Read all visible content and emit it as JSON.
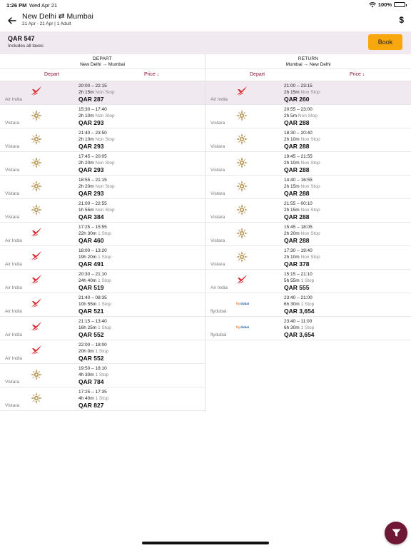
{
  "status_bar": {
    "time": "1:26 PM",
    "date": "Wed Apr 21",
    "battery": "100%"
  },
  "header": {
    "title": "New Delhi ⇄ Mumbai",
    "subtitle": "21 Apr - 21 Apr | 1 Adult",
    "back_icon": "arrow-left-icon",
    "currency_icon": "dollar-icon"
  },
  "summary": {
    "price": "QAR 547",
    "note": "Includes all taxes",
    "book_label": "Book"
  },
  "depart": {
    "heading": "DEPART",
    "route": "New Delhi → Mumbai",
    "sort_left": "Depart",
    "sort_right": "Price ↓",
    "flights": [
      {
        "airline": "Air India",
        "logo": "air-india",
        "times": "20:00  –  22:15",
        "duration": "2h 15m",
        "stops": "Non Stop",
        "price": "QAR 287",
        "selected": true
      },
      {
        "airline": "Vistara",
        "logo": "vistara",
        "times": "15:30  –  17:40",
        "duration": "2h 10m",
        "stops": "Non Stop",
        "price": "QAR 293"
      },
      {
        "airline": "Vistara",
        "logo": "vistara",
        "times": "21:40  –  23:50",
        "duration": "2h 10m",
        "stops": "Non Stop",
        "price": "QAR 293"
      },
      {
        "airline": "Vistara",
        "logo": "vistara",
        "times": "17:45  –  20:05",
        "duration": "2h 20m",
        "stops": "Non Stop",
        "price": "QAR 293"
      },
      {
        "airline": "Vistara",
        "logo": "vistara",
        "times": "18:55  –  21:15",
        "duration": "2h 20m",
        "stops": "Non Stop",
        "price": "QAR 293"
      },
      {
        "airline": "Vistara",
        "logo": "vistara",
        "times": "21:00  –  22:55",
        "duration": "1h 55m",
        "stops": "Non Stop",
        "price": "QAR 384"
      },
      {
        "airline": "Air India",
        "logo": "air-india",
        "times": "17:25  –  15:55",
        "duration": "22h 30m",
        "stops": "1 Stop",
        "price": "QAR 460"
      },
      {
        "airline": "Air India",
        "logo": "air-india",
        "times": "18:00  –  13:20",
        "duration": "19h 20m",
        "stops": "1 Stop",
        "price": "QAR 491"
      },
      {
        "airline": "Air India",
        "logo": "air-india",
        "times": "20:30  –  21:10",
        "duration": "24h 40m",
        "stops": "1 Stop",
        "price": "QAR 519"
      },
      {
        "airline": "Air India",
        "logo": "air-india",
        "times": "21:40  –  08:35",
        "duration": "10h 55m",
        "stops": "1 Stop",
        "price": "QAR 521"
      },
      {
        "airline": "Air India",
        "logo": "air-india",
        "times": "21:15  –  13:40",
        "duration": "16h 25m",
        "stops": "1 Stop",
        "price": "QAR 552"
      },
      {
        "airline": "Air India",
        "logo": "air-india",
        "times": "22:00  –  18:00",
        "duration": "20h 0m",
        "stops": "1 Stop",
        "price": "QAR 552"
      },
      {
        "airline": "Vistara",
        "logo": "vistara",
        "times": "19:50  –  18:10",
        "duration": "4h 30m",
        "stops": "1 Stop",
        "price": "QAR 784"
      },
      {
        "airline": "Vistara",
        "logo": "vistara",
        "times": "17:25  –  17:35",
        "duration": "4h 40m",
        "stops": "1 Stop",
        "price": "QAR 827"
      }
    ]
  },
  "return": {
    "heading": "RETURN",
    "route": "Mumbai → New Delhi",
    "sort_left": "Depart",
    "sort_right": "Price ↓",
    "flights": [
      {
        "airline": "Air India",
        "logo": "air-india",
        "times": "21:00  –  23:15",
        "duration": "2h 15m",
        "stops": "Non Stop",
        "price": "QAR 260",
        "selected": true
      },
      {
        "airline": "Vistara",
        "logo": "vistara",
        "times": "20:55  –  23:00",
        "duration": "2h 5m",
        "stops": "Non Stop",
        "price": "QAR 288"
      },
      {
        "airline": "Vistara",
        "logo": "vistara",
        "times": "18:30  –  20:40",
        "duration": "2h 10m",
        "stops": "Non Stop",
        "price": "QAR 288"
      },
      {
        "airline": "Vistara",
        "logo": "vistara",
        "times": "19:45  –  21:55",
        "duration": "2h 10m",
        "stops": "Non Stop",
        "price": "QAR 288"
      },
      {
        "airline": "Vistara",
        "logo": "vistara",
        "times": "14:40  –  16:55",
        "duration": "2h 15m",
        "stops": "Non Stop",
        "price": "QAR 288"
      },
      {
        "airline": "Vistara",
        "logo": "vistara",
        "times": "21:55  –  00:10",
        "duration": "2h 15m",
        "stops": "Non Stop",
        "price": "QAR 288"
      },
      {
        "airline": "Vistara",
        "logo": "vistara",
        "times": "15:45  –  18:05",
        "duration": "2h 20m",
        "stops": "Non Stop",
        "price": "QAR 288"
      },
      {
        "airline": "Vistara",
        "logo": "vistara",
        "times": "17:30  –  19:40",
        "duration": "2h 10m",
        "stops": "Non Stop",
        "price": "QAR 378"
      },
      {
        "airline": "Air India",
        "logo": "air-india",
        "times": "15:15  –  21:10",
        "duration": "5h 55m",
        "stops": "1 Stop",
        "price": "QAR 555"
      },
      {
        "airline": "flydubai",
        "logo": "flydubai",
        "times": "23:40  –  21:00",
        "duration": "6h 30m",
        "stops": "1 Stop",
        "price": "QAR 3,654"
      },
      {
        "airline": "flydubai",
        "logo": "flydubai",
        "times": "23:40  –  11:00",
        "duration": "6h 30m",
        "stops": "1 Stop",
        "price": "QAR 3,654"
      }
    ]
  },
  "colors": {
    "accent": "#8a1538",
    "book": "#f8a70f",
    "selected_bg": "#f0e9ef",
    "fab": "#6f1836"
  },
  "fab": {
    "icon": "filter-icon"
  }
}
